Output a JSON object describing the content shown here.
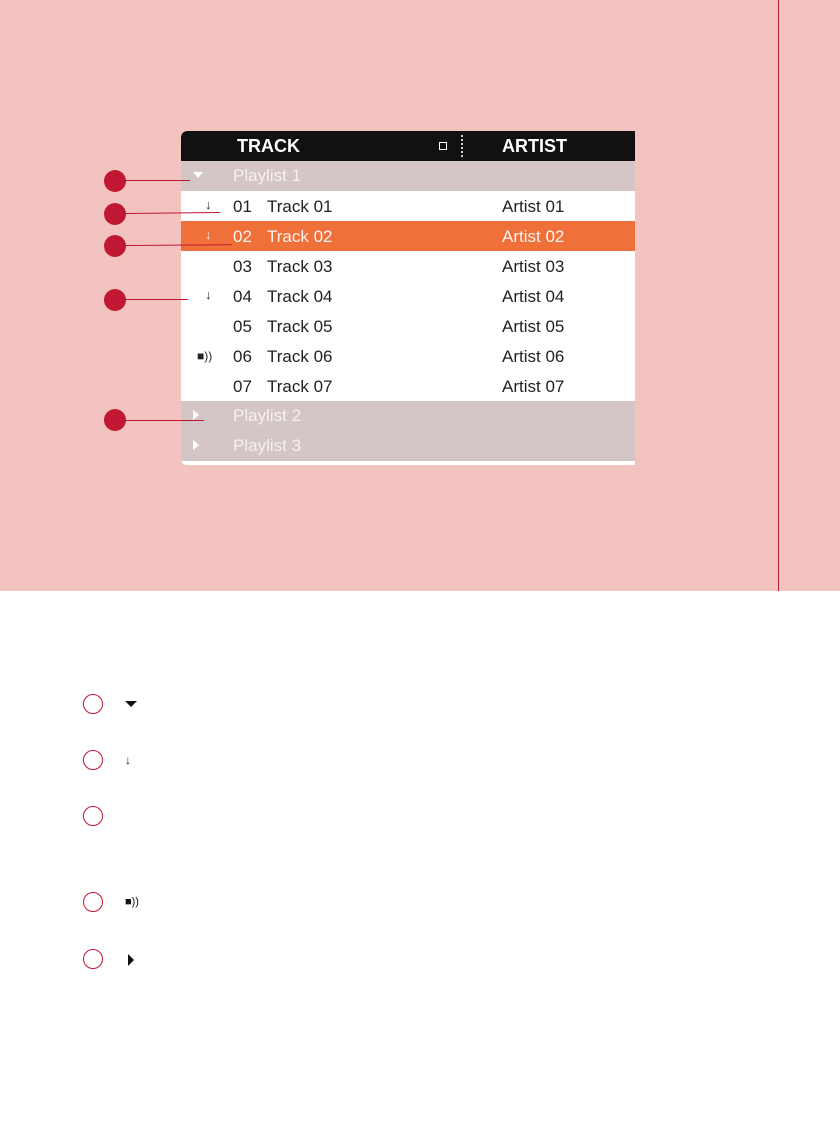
{
  "columns": {
    "track": "TRACK",
    "artist": "ARTIST"
  },
  "playlists": [
    {
      "label": "Playlist 1",
      "state": "expanded"
    },
    {
      "label": "Playlist 2",
      "state": "collapsed"
    },
    {
      "label": "Playlist 3",
      "state": "collapsed"
    }
  ],
  "tracks": [
    {
      "number": "01",
      "title": "Track 01",
      "artist": "Artist 01",
      "icon": "down-arrow-icon",
      "selected": false
    },
    {
      "number": "02",
      "title": "Track 02",
      "artist": "Artist 02",
      "icon": "down-arrow-icon",
      "selected": true
    },
    {
      "number": "03",
      "title": "Track 03",
      "artist": "Artist 03",
      "icon": "",
      "selected": false
    },
    {
      "number": "04",
      "title": "Track 04",
      "artist": "Artist 04",
      "icon": "down-arrow-icon",
      "selected": false
    },
    {
      "number": "05",
      "title": "Track 05",
      "artist": "Artist 05",
      "icon": "",
      "selected": false
    },
    {
      "number": "06",
      "title": "Track 06",
      "artist": "Artist 06",
      "icon": "speaker-icon",
      "selected": false
    },
    {
      "number": "07",
      "title": "Track 07",
      "artist": "Artist 07",
      "icon": "",
      "selected": false
    }
  ],
  "legend": [
    {
      "icon": "triangle-down-icon"
    },
    {
      "icon": "down-arrow-icon"
    },
    {
      "icon": ""
    },
    {
      "icon": "speaker-icon"
    },
    {
      "icon": "triangle-right-icon"
    }
  ],
  "colors": {
    "band": "#f3c4bf",
    "callout": "#c01833",
    "selected_row": "#f0703a",
    "playlist_row": "#d4c6c6",
    "header": "#111111"
  }
}
